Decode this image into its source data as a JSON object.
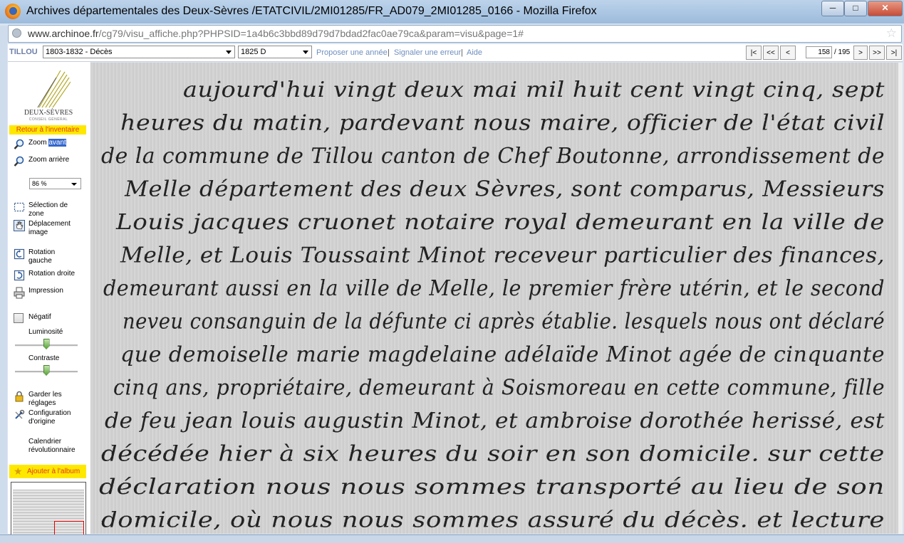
{
  "window": {
    "title": "Archives départementales des Deux-Sèvres /ETATCIVIL/2MI01285/FR_AD079_2MI01285_0166 - Mozilla Firefox",
    "min_label": "─",
    "max_label": "□",
    "close_label": "✕"
  },
  "address": {
    "domain": "www.archinoe.fr",
    "path": "/cg79/visu_affiche.php?PHPSID=1a4b6c3bbd89d79d7bdad2fac0ae79ca&param=visu&page=1#"
  },
  "toolbar": {
    "commune": "TILLOU",
    "period_select": "1803-1832 - Décès",
    "year_select": "1825 D",
    "link_propose": "Proposer une année",
    "link_error": "Signaler une erreur",
    "link_help": "Aide",
    "sep1": "|",
    "sep2": "|",
    "nav_first": "|<",
    "nav_prev_many": "<<",
    "nav_prev": "<",
    "current_page": "158",
    "total_pages": "/ 195",
    "nav_next": ">",
    "nav_next_many": ">>",
    "nav_last": ">|"
  },
  "sidebar": {
    "logo_text": "DEUX-SÈVRES",
    "logo_sub": "CONSEIL GÉNÉRAL",
    "back_link": "Retour à l'inventaire",
    "zoom_in_prefix": "Zoom ",
    "zoom_in_selected": "avant",
    "zoom_out": "Zoom arrière",
    "zoom_level": "86 %",
    "selection_zone_1": "Sélection de",
    "selection_zone_2": "zone",
    "move_image_1": "Déplacement",
    "move_image_2": "image",
    "rotate_left_1": "Rotation",
    "rotate_left_2": "gauche",
    "rotate_right": "Rotation droite",
    "print": "Impression",
    "negative": "Négatif",
    "brightness": "Luminosité",
    "contrast": "Contraste",
    "keep_settings_1": "Garder les",
    "keep_settings_2": "réglages",
    "config_origin_1": "Configuration",
    "config_origin_2": "d'origine",
    "calendar_1": "Calendrier",
    "calendar_2": "révolutionnaire",
    "album": "Ajouter à l'album"
  },
  "controls": {
    "brightness_level": 0.5,
    "contrast_level": 0.5,
    "negative_checked": false
  },
  "document": {
    "lines": [
      "aujourd'hui vingt deux mai mil huit cent vingt cinq, sept",
      "heures du matin, pardevant nous maire, officier de l'état civil",
      "de la commune de Tillou canton de Chef Boutonne, arrondissement de",
      "Melle département des deux Sèvres, sont comparus, Messieurs",
      "Louis jacques cruonet notaire royal demeurant en la ville de",
      "Melle, et Louis Toussaint Minot receveur particulier des finances,",
      "demeurant aussi en la ville de Melle, le premier frère utérin, et le second",
      "neveu consanguin de la défunte ci après établie. lesquels nous ont déclaré",
      "que demoiselle marie magdelaine adélaïde Minot agée de cinquante",
      "cinq ans, propriétaire, demeurant à Soismoreau en cette commune, fille",
      "de feu jean louis augustin Minot, et ambroise dorothée herissé, est",
      "décédée hier à six heures du soir en son domicile. sur cette",
      "déclaration nous nous sommes transporté au lieu de son",
      "domicile, où nous nous sommes assuré du décès. et lecture"
    ]
  }
}
